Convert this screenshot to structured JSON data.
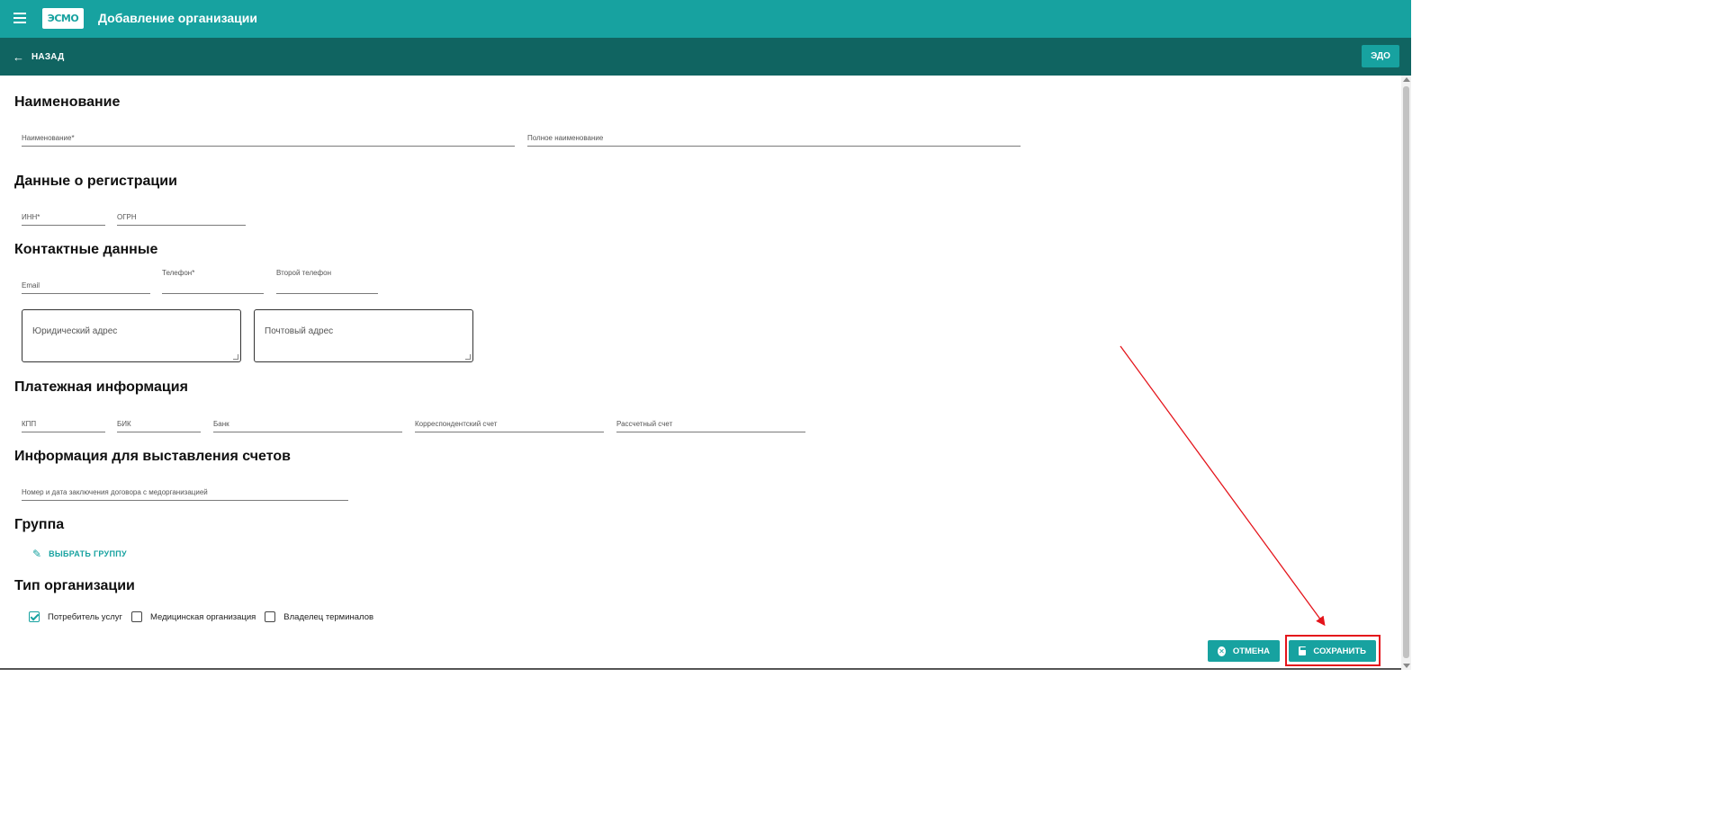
{
  "header": {
    "logo_text": "ЭСМО",
    "title": "Добавление организации"
  },
  "subheader": {
    "back_label": "НАЗАД",
    "edo_label": "ЭДО"
  },
  "sections": {
    "name": {
      "title": "Наименование",
      "name_placeholder": "Наименование*",
      "full_name_placeholder": "Полное наименование"
    },
    "registration": {
      "title": "Данные о регистрации",
      "inn_placeholder": "ИНН*",
      "ogrn_placeholder": "ОГРН"
    },
    "contacts": {
      "title": "Контактные данные",
      "email_placeholder": "Email",
      "phone_label": "Телефон*",
      "phone2_label": "Второй телефон",
      "legal_address_placeholder": "Юридический адрес",
      "postal_address_placeholder": "Почтовый адрес"
    },
    "payment": {
      "title": "Платежная информация",
      "kpp_placeholder": "КПП",
      "bik_placeholder": "БИК",
      "bank_placeholder": "Банк",
      "corr_account_placeholder": "Корреспондентский счет",
      "settlement_account_placeholder": "Рассчетный счет"
    },
    "invoicing": {
      "title": "Информация для выставления счетов",
      "contract_placeholder": "Номер и дата заключения договора с медорганизацией"
    },
    "group": {
      "title": "Группа",
      "select_group_label": "ВЫБРАТЬ ГРУППУ"
    },
    "org_type": {
      "title": "Тип организации",
      "options": [
        {
          "label": "Потребитель услуг",
          "checked": true
        },
        {
          "label": "Медицинская организация",
          "checked": false
        },
        {
          "label": "Владелец терминалов",
          "checked": false
        }
      ]
    }
  },
  "footer": {
    "cancel_label": "ОТМЕНА",
    "save_label": "СОХРАНИТЬ"
  },
  "colors": {
    "primary": "#17a2a0",
    "primary_dark": "#106461",
    "annotation": "#e4141b"
  },
  "icons": {
    "menu": "menu-icon",
    "back": "arrow-left-icon",
    "edit": "pencil-icon",
    "cancel": "cancel-circle-icon",
    "save": "floppy-disk-icon"
  }
}
